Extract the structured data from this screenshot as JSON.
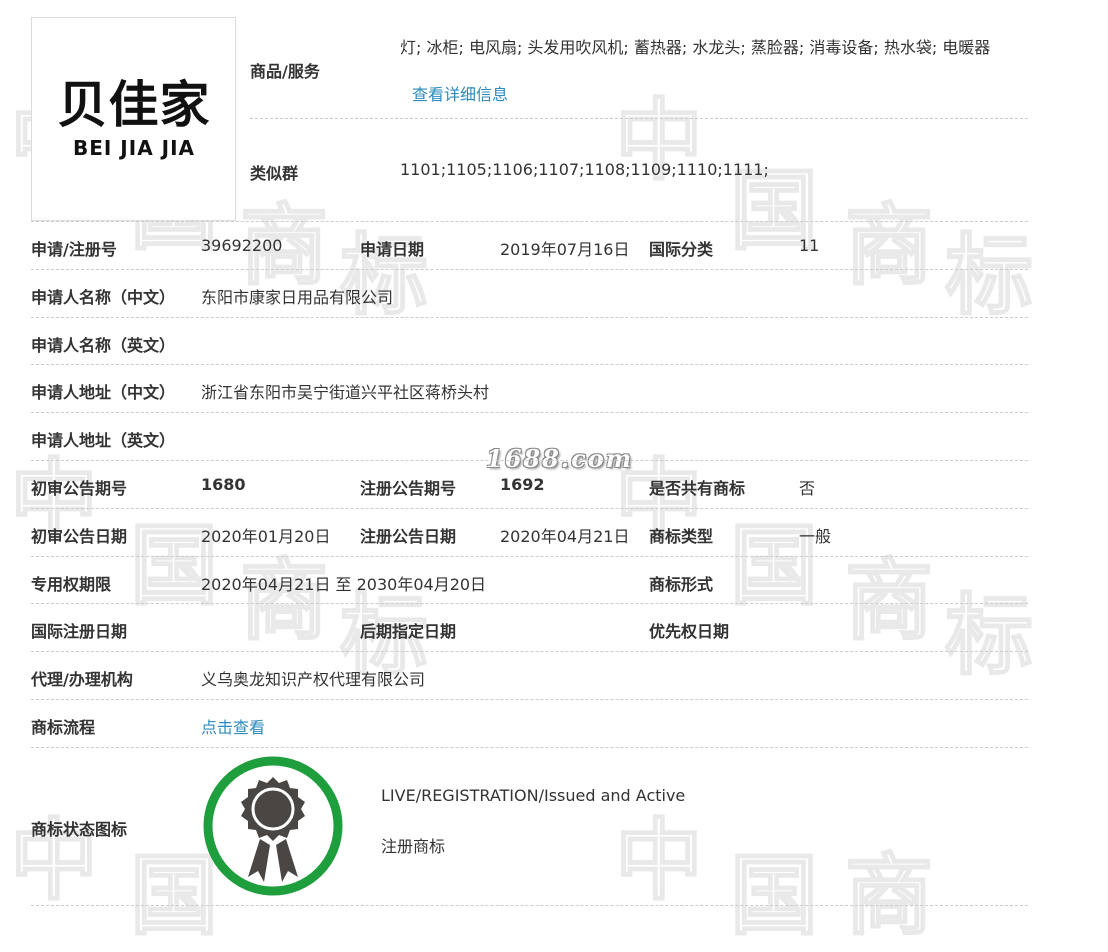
{
  "watermark": {
    "chars": [
      "中",
      "国",
      "商",
      "标"
    ],
    "site": "1688.com"
  },
  "logo": {
    "cn": "贝佳家",
    "en": "BEI JIA JIA"
  },
  "top": {
    "goods_label": "商品/服务",
    "goods_value": "灯; 冰柜; 电风扇; 头发用吹风机; 蓄热器; 水龙头; 蒸脸器; 消毒设备; 热水袋; 电暖器",
    "detail_link": "查看详细信息",
    "similar_label": "类似群",
    "similar_value": "1101;1105;1106;1107;1108;1109;1110;1111;"
  },
  "rows": {
    "reg_no_label": "申请/注册号",
    "reg_no": "39692200",
    "apply_date_label": "申请日期",
    "apply_date": "2019年07月16日",
    "intl_class_label": "国际分类",
    "intl_class": "11",
    "applicant_cn_label": "申请人名称（中文）",
    "applicant_cn": "东阳市康家日用品有限公司",
    "applicant_en_label": "申请人名称（英文）",
    "applicant_en": "",
    "address_cn_label": "申请人地址（中文）",
    "address_cn": "浙江省东阳市吴宁街道兴平社区蒋桥头村",
    "address_en_label": "申请人地址（英文）",
    "address_en": "",
    "prelim_no_label": "初审公告期号",
    "prelim_no": "1680",
    "reg_pub_no_label": "注册公告期号",
    "reg_pub_no": "1692",
    "shared_label": "是否共有商标",
    "shared": "否",
    "prelim_date_label": "初审公告日期",
    "prelim_date": "2020年01月20日",
    "reg_pub_date_label": "注册公告日期",
    "reg_pub_date": "2020年04月21日",
    "tm_type_label": "商标类型",
    "tm_type": "一般",
    "exclusive_label": "专用权期限",
    "exclusive": "2020年04月21日 至 2030年04月20日",
    "tm_form_label": "商标形式",
    "tm_form": "",
    "intl_reg_date_label": "国际注册日期",
    "later_date_label": "后期指定日期",
    "priority_date_label": "优先权日期",
    "agent_label": "代理/办理机构",
    "agent": "义乌奥龙知识产权代理有限公司",
    "process_label": "商标流程",
    "process_link": "点击查看",
    "status_icon_label": "商标状态图标"
  },
  "status": {
    "en": "LIVE/REGISTRATION/Issued and Active",
    "cn": "注册商标",
    "seal_color": "#1e9e3c"
  }
}
